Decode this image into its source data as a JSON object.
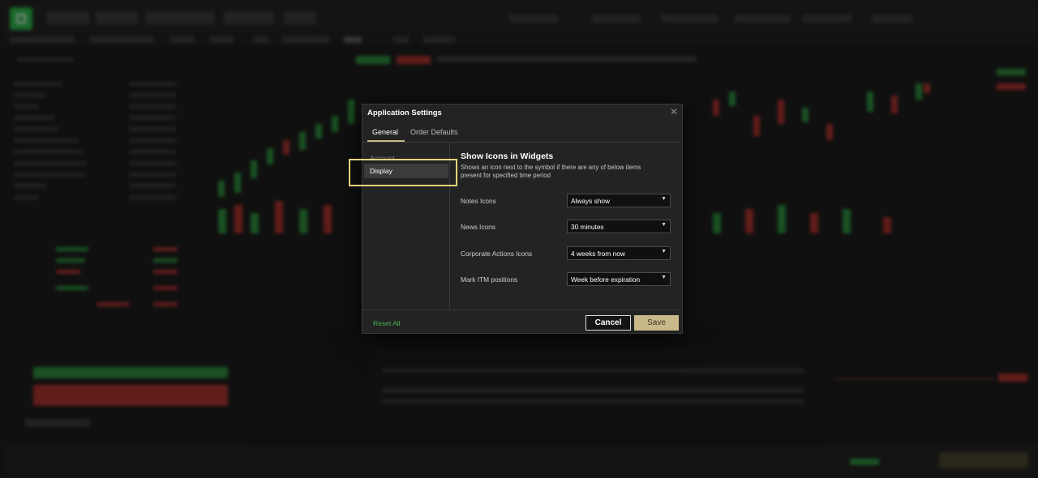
{
  "dialog": {
    "title": "Application Settings",
    "tabs": [
      {
        "label": "General",
        "active": true
      },
      {
        "label": "Order Defaults",
        "active": false
      }
    ],
    "sidebar": [
      {
        "label": "Account",
        "selected": false
      },
      {
        "label": "Display",
        "selected": true
      }
    ],
    "section": {
      "title": "Show Icons in Widgets",
      "description": "Shows an icon next to the symbol if there are any of below items present for specified time period"
    },
    "settings": [
      {
        "label": "Notes Icons",
        "value": "Always show"
      },
      {
        "label": "News Icons",
        "value": "30 minutes"
      },
      {
        "label": "Corporate Actions Icons",
        "value": "4 weeks from now"
      },
      {
        "label": "Mark ITM positions",
        "value": "Week before expiration"
      }
    ],
    "footer": {
      "reset_label": "Reset All",
      "cancel_label": "Cancel",
      "save_label": "Save"
    }
  },
  "colors": {
    "accent": "#c9b98a",
    "reset_link": "#49b34f",
    "highlight": "#e6d37a",
    "brand_green": "#2db34a"
  },
  "icons": {
    "close": "close-icon",
    "select_caret": "chevron-down-icon"
  }
}
